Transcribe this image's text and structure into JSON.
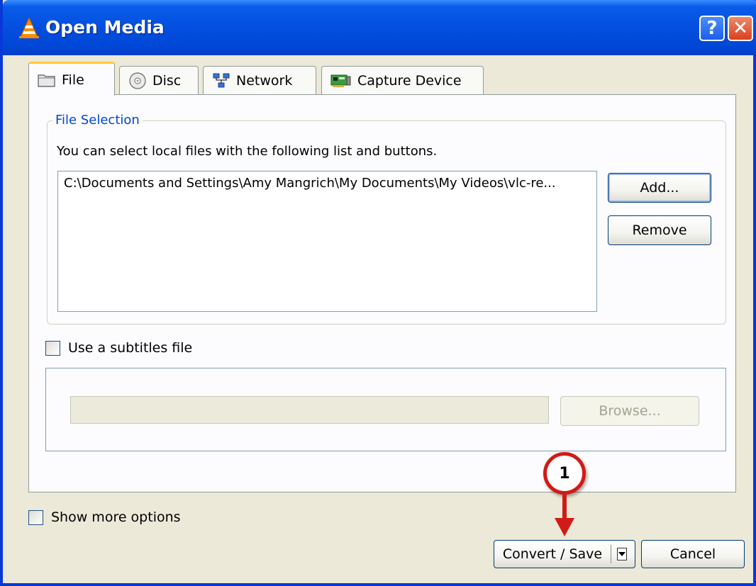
{
  "window": {
    "title": "Open Media",
    "help_label": "?",
    "close_label": "✕"
  },
  "tabs": [
    {
      "label": "File",
      "icon": "folder-icon",
      "active": true
    },
    {
      "label": "Disc",
      "icon": "disc-icon",
      "active": false
    },
    {
      "label": "Network",
      "icon": "network-icon",
      "active": false
    },
    {
      "label": "Capture Device",
      "icon": "capture-card-icon",
      "active": false
    }
  ],
  "file_selection": {
    "group_label": "File Selection",
    "hint": "You can select local files with the following list and buttons.",
    "files": [
      "C:\\Documents and Settings\\Amy Mangrich\\My Documents\\My Videos\\vlc-re..."
    ],
    "add_label": "Add...",
    "remove_label": "Remove"
  },
  "subtitles": {
    "checkbox_label": "Use a subtitles file",
    "checked": false,
    "path_value": "",
    "browse_label": "Browse..."
  },
  "footer": {
    "more_options_label": "Show more options",
    "more_options_checked": false,
    "convert_label": "Convert / Save",
    "cancel_label": "Cancel"
  },
  "annotation": {
    "step": "1",
    "color": "#d11b16"
  },
  "colors": {
    "title_bar": "#0450e0",
    "window_bg": "#ece9d8",
    "group_label": "#0046d5"
  }
}
